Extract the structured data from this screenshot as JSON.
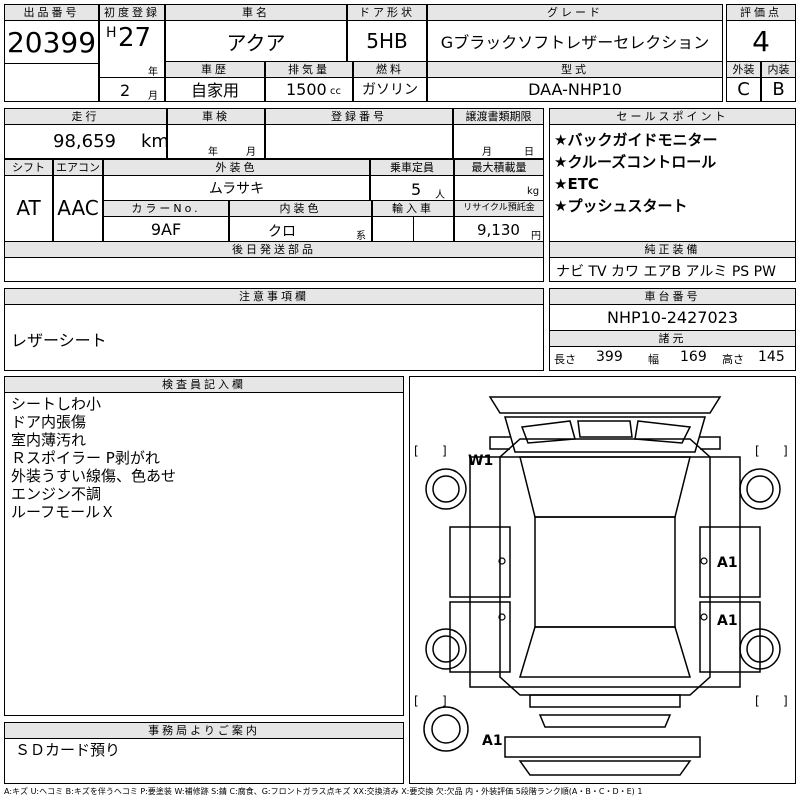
{
  "headers": {
    "lot_no": "出品番号",
    "first_reg": "初度登録",
    "car_name": "車名",
    "door": "ドア形状",
    "grade": "グレード",
    "score": "評価点",
    "history": "車歴",
    "displacement": "排気量",
    "fuel": "燃料",
    "model": "型式",
    "exterior": "外装",
    "interior": "内装",
    "mileage": "走行",
    "inspection": "車検",
    "reg_no": "登録番号",
    "transfer": "譲渡書類期限",
    "selling_points": "セールスポイント",
    "shift": "シフト",
    "aircon": "エアコン",
    "ext_color": "外装色",
    "capacity": "乗車定員",
    "max_load": "最大積載量",
    "color_no": "カラーNo.",
    "int_color": "内装色",
    "import": "輸入車",
    "recycle": "リサイクル預託金",
    "later_parts": "後日発送部品",
    "genuine": "純正装備",
    "caution": "注意事項欄",
    "chassis_no": "車台番号",
    "specs": "諸元",
    "inspector": "検査員記入欄",
    "office": "事務局よりご案内"
  },
  "units": {
    "year": "年",
    "month": "月",
    "cc": "cc",
    "km": "km",
    "person": "人",
    "kg": "kg",
    "yen": "円",
    "kei": "系"
  },
  "values": {
    "lot_no": "20399",
    "era": "H",
    "year": "27",
    "month": "2",
    "car_name": "アクア",
    "door": "5HB",
    "grade": "Gブラックソフトレザーセレクション",
    "score": "4",
    "history": "自家用",
    "displacement": "1500",
    "fuel": "ガソリン",
    "model": "DAA-NHP10",
    "exterior": "C",
    "interior": "B",
    "mileage": "98,659",
    "shift": "AT",
    "aircon": "AAC",
    "ext_color": "ムラサキ",
    "capacity": "5",
    "color_no": "9AF",
    "int_color": "クロ",
    "recycle": "9,130",
    "chassis_no": "NHP10-2427023",
    "length_label": "長さ",
    "length": "399",
    "width_label": "幅",
    "width": "169",
    "height_label": "高さ",
    "height": "145"
  },
  "selling_points": [
    "★バックガイドモニター",
    "★クルーズコントロール",
    "★ETC",
    "★プッシュスタート"
  ],
  "genuine_equipment": "ナビ TV カワ エアB アルミ PS PW",
  "caution_text": "レザーシート",
  "inspector_notes": [
    "シートしわ小",
    "ドア内張傷",
    "室内薄汚れ",
    "Ｒスポイラー P剥がれ",
    "外装うすい線傷、色あせ",
    "エンジン不調",
    "ルーフモールＸ"
  ],
  "office_note": "ＳＤカード預り",
  "diagram_marks": {
    "front": "W1",
    "right_front_door": "A1",
    "right_rear_door": "A1",
    "rear_left": "A1",
    "bracket_open": "[",
    "bracket_close": "]"
  },
  "legend": "A:キズ U:ヘコミ B:キズを伴うヘコミ P:要塗装 W:補修跡 S:錆 C:腐食、G:フロントガラス点キズ XX:交換済み X:要交換 欠:欠品 内・外装評価 5段階ランク順(A・B・C・D・E) 1"
}
